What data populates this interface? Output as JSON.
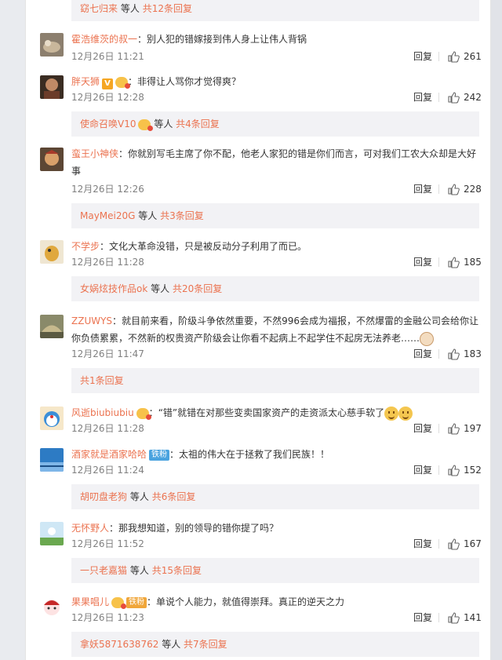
{
  "top_sub": {
    "name": "窈七归来",
    "suffix": "等人",
    "count": "共12条回复"
  },
  "comments": [
    {
      "user": "霍浩维茨的叔一",
      "text": "别人犯的错嫁接到伟人身上让伟人背锅",
      "time": "12月26日 11:21",
      "reply": "回复",
      "likes": "261"
    },
    {
      "user": "胖天狮",
      "text": "非得让人骂你才觉得爽？",
      "time": "12月26日 12:28",
      "reply": "回复",
      "likes": "242",
      "sub": {
        "name": "使命召唤V10",
        "suffix": "等人",
        "count": "共4条回复"
      }
    },
    {
      "user": "蛮王小神侠",
      "text": "你就别写毛主席了你不配，他老人家犯的错是你们而言，可对我们工农大众却是大好事",
      "time": "12月26日 12:26",
      "reply": "回复",
      "likes": "228",
      "sub": {
        "name": "MayMei20G",
        "suffix": "等人",
        "count": "共3条回复"
      }
    },
    {
      "user": "不学步",
      "text": "文化大革命没错，只是被反动分子利用了而已。",
      "time": "12月26日 11:28",
      "reply": "回复",
      "likes": "185",
      "sub": {
        "name": "女娲炫技作品ok",
        "suffix": "等人",
        "count": "共20条回复"
      }
    },
    {
      "user": "ZZUWYS",
      "text": "就目前来看，阶级斗争依然重要，不然996会成为福报，不然爆雷的金融公司会给你让你负债累累，不然新的权贵资产阶级会让你看不起病上不起学住不起房无法养老……",
      "time": "12月26日 11:47",
      "reply": "回复",
      "likes": "183",
      "sub": {
        "name": "",
        "suffix": "",
        "count": "共1条回复"
      }
    },
    {
      "user": "风逝biubiubiu",
      "text": "“错”就错在对那些变卖国家资产的走资派太心慈手软了",
      "time": "12月26日 11:28",
      "reply": "回复",
      "likes": "197"
    },
    {
      "user": "酒家就是酒家哈哈",
      "badge": "铁粉",
      "text": "太祖的伟大在于拯救了我们民族！！",
      "time": "12月26日 11:24",
      "reply": "回复",
      "likes": "152",
      "sub": {
        "name": "胡叨盘老狗",
        "suffix": "等人",
        "count": "共6条回复"
      }
    },
    {
      "user": "无怀野人",
      "text": "那我想知道，别的领导的错你提了吗？",
      "time": "12月26日 11:52",
      "reply": "回复",
      "likes": "167",
      "sub": {
        "name": "一只老嘉猫",
        "suffix": "等人",
        "count": "共15条回复"
      }
    },
    {
      "user": "果果唱儿",
      "badge": "铁粉",
      "text": "单说个人能力，就值得崇拜。真正的逆天之力",
      "time": "12月26日 11:23",
      "reply": "回复",
      "likes": "141",
      "sub": {
        "name": "拿妖5871638762",
        "suffix": "等人",
        "count": "共7条回复"
      }
    }
  ],
  "colors": {
    "accent": "#eb7350",
    "subbg": "#f2f2f5",
    "meta": "#808080"
  }
}
